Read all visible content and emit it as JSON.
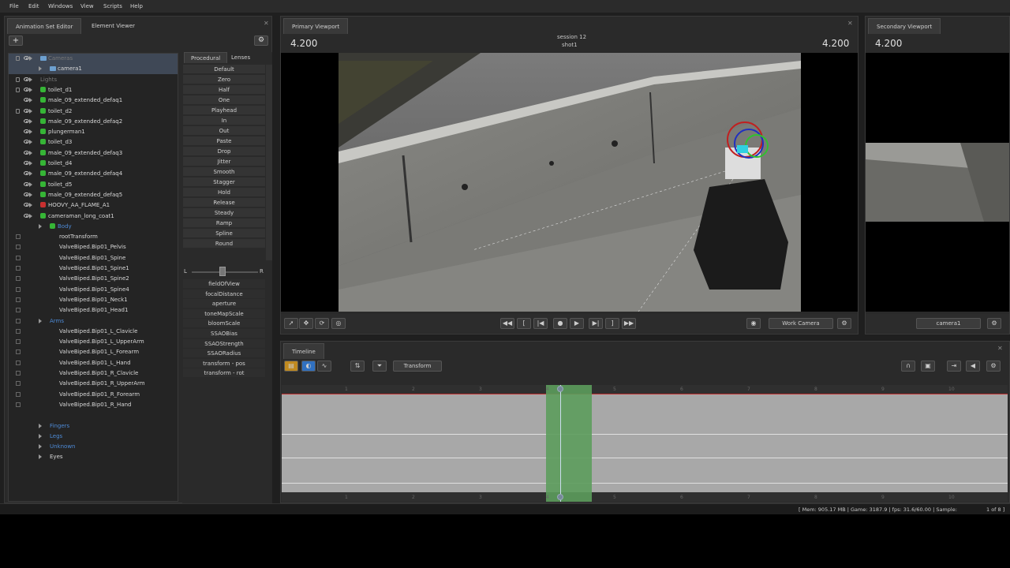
{
  "menu": [
    "File",
    "Edit",
    "Windows",
    "View",
    "Scripts",
    "Help"
  ],
  "left_panel": {
    "tabs": [
      "Animation Set Editor",
      "Element Viewer"
    ],
    "add_label": "+",
    "proc_tabs": [
      "Procedural",
      "Lenses"
    ],
    "tree": [
      {
        "label": "Cameras",
        "indent": 0,
        "style": "dim",
        "icon": "folder",
        "eye": true,
        "lock": true,
        "sel": true
      },
      {
        "label": "camera1",
        "indent": 1,
        "style": "",
        "icon": "folder",
        "eye": false,
        "lock": false,
        "sel": true
      },
      {
        "label": "Lights",
        "indent": 0,
        "style": "dim",
        "icon": "",
        "eye": true,
        "lock": true,
        "sel": false
      },
      {
        "label": "toilet_d1",
        "indent": 0,
        "style": "",
        "icon": "gem",
        "eye": true,
        "lock": true,
        "sel": false
      },
      {
        "label": "male_09_extended_defaq1",
        "indent": 0,
        "style": "",
        "icon": "gem",
        "eye": true,
        "lock": false,
        "sel": false
      },
      {
        "label": "toilet_d2",
        "indent": 0,
        "style": "",
        "icon": "gem",
        "eye": true,
        "lock": true,
        "sel": false
      },
      {
        "label": "male_09_extended_defaq2",
        "indent": 0,
        "style": "",
        "icon": "gem",
        "eye": true,
        "lock": false,
        "sel": false
      },
      {
        "label": "plungerman1",
        "indent": 0,
        "style": "",
        "icon": "gem",
        "eye": true,
        "lock": false,
        "sel": false
      },
      {
        "label": "toilet_d3",
        "indent": 0,
        "style": "",
        "icon": "gem",
        "eye": true,
        "lock": false,
        "sel": false
      },
      {
        "label": "male_09_extended_defaq3",
        "indent": 0,
        "style": "",
        "icon": "gem",
        "eye": true,
        "lock": false,
        "sel": false
      },
      {
        "label": "toilet_d4",
        "indent": 0,
        "style": "",
        "icon": "gem",
        "eye": true,
        "lock": false,
        "sel": false
      },
      {
        "label": "male_09_extended_defaq4",
        "indent": 0,
        "style": "",
        "icon": "gem",
        "eye": true,
        "lock": false,
        "sel": false
      },
      {
        "label": "toilet_d5",
        "indent": 0,
        "style": "",
        "icon": "gem",
        "eye": true,
        "lock": false,
        "sel": false
      },
      {
        "label": "male_09_extended_defaq5",
        "indent": 0,
        "style": "",
        "icon": "gem",
        "eye": true,
        "lock": false,
        "sel": false
      },
      {
        "label": "HOOVY_AA_FLAME_A1",
        "indent": 0,
        "style": "",
        "icon": "red",
        "eye": true,
        "lock": false,
        "sel": false
      },
      {
        "label": "cameraman_long_coat1",
        "indent": 0,
        "style": "",
        "icon": "gem",
        "eye": true,
        "lock": false,
        "sel": false
      },
      {
        "label": "Body",
        "indent": 1,
        "style": "blue",
        "icon": "gem",
        "eye": false,
        "lock": false,
        "sel": false
      },
      {
        "label": "rootTransform",
        "indent": 2,
        "style": "",
        "icon": "",
        "eye": false,
        "lock": false,
        "chk": true,
        "sel": false
      },
      {
        "label": "ValveBiped.Bip01_Pelvis",
        "indent": 2,
        "style": "",
        "icon": "",
        "eye": false,
        "lock": false,
        "chk": true,
        "sel": false
      },
      {
        "label": "ValveBiped.Bip01_Spine",
        "indent": 2,
        "style": "",
        "icon": "",
        "eye": false,
        "lock": false,
        "chk": true,
        "sel": false
      },
      {
        "label": "ValveBiped.Bip01_Spine1",
        "indent": 2,
        "style": "",
        "icon": "",
        "eye": false,
        "lock": false,
        "chk": true,
        "sel": false
      },
      {
        "label": "ValveBiped.Bip01_Spine2",
        "indent": 2,
        "style": "",
        "icon": "",
        "eye": false,
        "lock": false,
        "chk": true,
        "sel": false
      },
      {
        "label": "ValveBiped.Bip01_Spine4",
        "indent": 2,
        "style": "",
        "icon": "",
        "eye": false,
        "lock": false,
        "chk": true,
        "sel": false
      },
      {
        "label": "ValveBiped.Bip01_Neck1",
        "indent": 2,
        "style": "",
        "icon": "",
        "eye": false,
        "lock": false,
        "chk": true,
        "sel": false
      },
      {
        "label": "ValveBiped.Bip01_Head1",
        "indent": 2,
        "style": "",
        "icon": "",
        "eye": false,
        "lock": false,
        "chk": true,
        "sel": false
      },
      {
        "label": "Arms",
        "indent": 1,
        "style": "blue",
        "icon": "",
        "eye": false,
        "lock": false,
        "chk": true,
        "sel": false
      },
      {
        "label": "ValveBiped.Bip01_L_Clavicle",
        "indent": 2,
        "style": "",
        "icon": "",
        "eye": false,
        "lock": false,
        "chk": true,
        "sel": false
      },
      {
        "label": "ValveBiped.Bip01_L_UpperArm",
        "indent": 2,
        "style": "",
        "icon": "",
        "eye": false,
        "lock": false,
        "chk": true,
        "sel": false
      },
      {
        "label": "ValveBiped.Bip01_L_Forearm",
        "indent": 2,
        "style": "",
        "icon": "",
        "eye": false,
        "lock": false,
        "chk": true,
        "sel": false
      },
      {
        "label": "ValveBiped.Bip01_L_Hand",
        "indent": 2,
        "style": "",
        "icon": "",
        "eye": false,
        "lock": false,
        "chk": true,
        "sel": false
      },
      {
        "label": "ValveBiped.Bip01_R_Clavicle",
        "indent": 2,
        "style": "",
        "icon": "",
        "eye": false,
        "lock": false,
        "chk": true,
        "sel": false
      },
      {
        "label": "ValveBiped.Bip01_R_UpperArm",
        "indent": 2,
        "style": "",
        "icon": "",
        "eye": false,
        "lock": false,
        "chk": true,
        "sel": false
      },
      {
        "label": "ValveBiped.Bip01_R_Forearm",
        "indent": 2,
        "style": "",
        "icon": "",
        "eye": false,
        "lock": false,
        "chk": true,
        "sel": false
      },
      {
        "label": "ValveBiped.Bip01_R_Hand",
        "indent": 2,
        "style": "",
        "icon": "",
        "eye": false,
        "lock": false,
        "chk": true,
        "sel": false
      },
      {
        "label": "",
        "indent": 1,
        "style": "",
        "icon": "",
        "eye": false,
        "lock": false,
        "sel": false
      },
      {
        "label": "Fingers",
        "indent": 1,
        "style": "blue",
        "icon": "",
        "eye": false,
        "lock": false,
        "sel": false
      },
      {
        "label": "Legs",
        "indent": 1,
        "style": "blue",
        "icon": "",
        "eye": false,
        "lock": false,
        "sel": false
      },
      {
        "label": "Unknown",
        "indent": 1,
        "style": "blue",
        "icon": "",
        "eye": false,
        "lock": false,
        "sel": false
      },
      {
        "label": "Eyes",
        "indent": 1,
        "style": "",
        "icon": "",
        "eye": false,
        "lock": false,
        "sel": false
      }
    ],
    "procedural": [
      "Default",
      "Zero",
      "Half",
      "One",
      "Playhead",
      "In",
      "Out",
      "Paste",
      "Drop",
      "Jitter",
      "Smooth",
      "Stagger",
      "Hold",
      "Release",
      "Steady",
      "Ramp",
      "Spline",
      "Round"
    ],
    "slider_left": "L",
    "slider_right": "R",
    "camera_props": [
      "fieldOfView",
      "focalDistance",
      "aperture",
      "toneMapScale",
      "bloomScale",
      "SSAOBias",
      "SSAOStrength",
      "SSAORadius",
      "transform - pos",
      "transform - rot"
    ]
  },
  "primary_viewport": {
    "tab": "Primary Viewport",
    "left_num": "4.200",
    "right_num": "4.200",
    "session": "session 12",
    "shot": "shot1",
    "camera_dropdown": "Work Camera"
  },
  "secondary_viewport": {
    "tab": "Secondary Viewport",
    "num": "4.200",
    "camera_dropdown": "camera1"
  },
  "timeline": {
    "tab": "Timeline",
    "mode_dropdown": "Transform",
    "ticks": [
      "1",
      "2",
      "3",
      "4",
      "5",
      "6",
      "7",
      "8",
      "9",
      "10"
    ]
  },
  "status": {
    "mem": "[ Mem:   905.17 MB | Game:    3187.9 | fps:    31.6/60.00 | Sample:",
    "page": "1 of 8 ]"
  },
  "colors": {
    "selection_green": "#5c9c5c",
    "blue_group": "#4d8ad6",
    "gem_green": "#36b536"
  }
}
